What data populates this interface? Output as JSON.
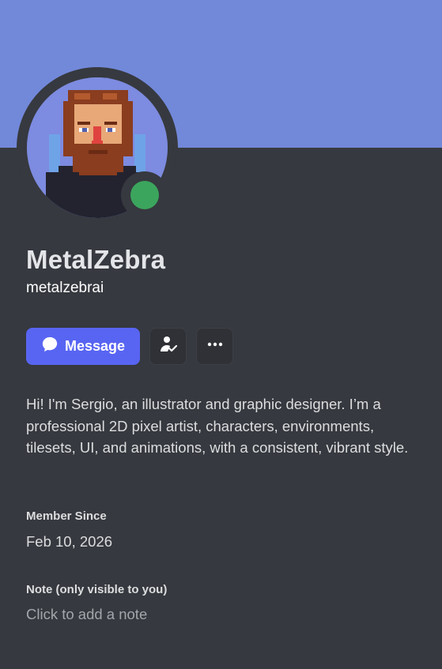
{
  "profile": {
    "display_name": "MetalZebra",
    "username": "metalzebrai",
    "status": "online",
    "bio": "Hi! I'm Sergio, an illustrator and graphic designer. I’m a professional 2D pixel artist, characters, environments, tilesets, UI, and animations, with a consistent, vibrant style."
  },
  "actions": {
    "message_label": "Message",
    "add_friend_icon": "user-check-icon",
    "more_icon": "more-horizontal-icon"
  },
  "member_since": {
    "label": "Member Since",
    "value": "Feb 10, 2026"
  },
  "note": {
    "label": "Note (only visible to you)",
    "placeholder": "Click to add a note"
  },
  "colors": {
    "banner": "#7289da",
    "background": "#36393f",
    "accent": "#5865f2",
    "status_online": "#3ba55d"
  }
}
